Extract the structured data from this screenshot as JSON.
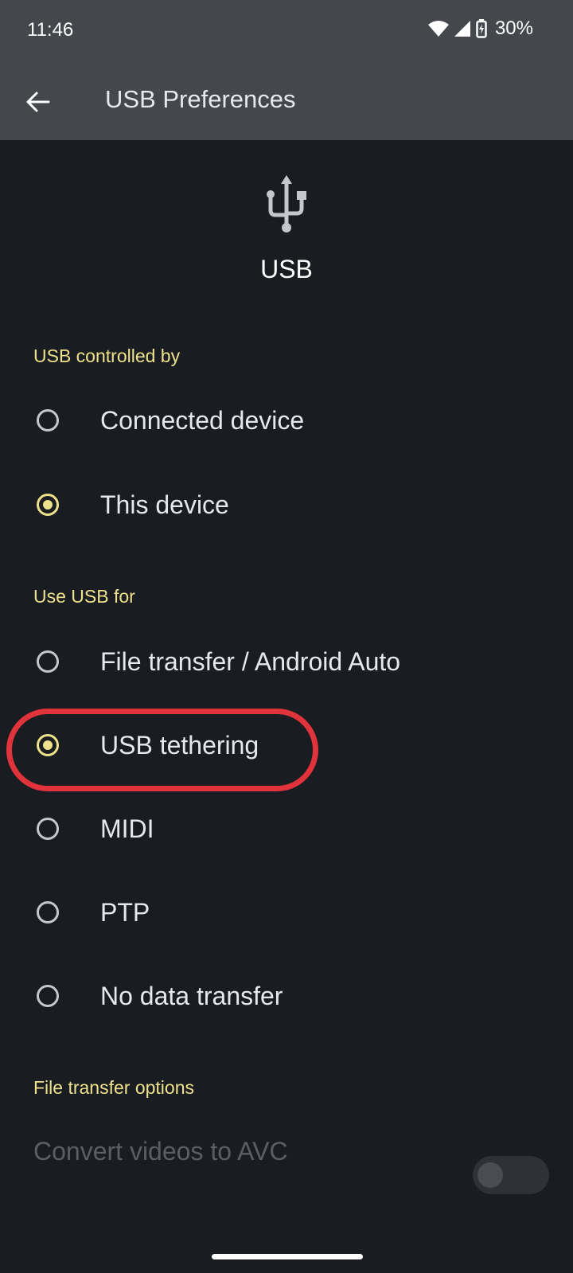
{
  "status_bar": {
    "time": "11:46",
    "battery_percent": "30%",
    "icons": [
      "wifi-icon",
      "cell-signal-icon",
      "battery-charging-icon"
    ]
  },
  "app_bar": {
    "title": "USB Preferences",
    "back_icon": "arrow-back-icon"
  },
  "header": {
    "icon": "usb-icon",
    "label": "USB"
  },
  "sections": {
    "controlled_by": {
      "title": "USB controlled by",
      "options": [
        {
          "label": "Connected device",
          "selected": false
        },
        {
          "label": "This device",
          "selected": true
        }
      ]
    },
    "use_usb_for": {
      "title": "Use USB for",
      "options": [
        {
          "label": "File transfer / Android Auto",
          "selected": false
        },
        {
          "label": "USB tethering",
          "selected": true
        },
        {
          "label": "MIDI",
          "selected": false
        },
        {
          "label": "PTP",
          "selected": false
        },
        {
          "label": "No data transfer",
          "selected": false
        }
      ]
    },
    "file_transfer_options": {
      "title": "File transfer options",
      "convert_videos": {
        "label": "Convert videos to AVC",
        "enabled": false,
        "on": false
      }
    }
  },
  "colors": {
    "accent": "#eee18c",
    "background": "#191c20",
    "top_bar": "#44474c",
    "highlight": "#e0333b"
  }
}
